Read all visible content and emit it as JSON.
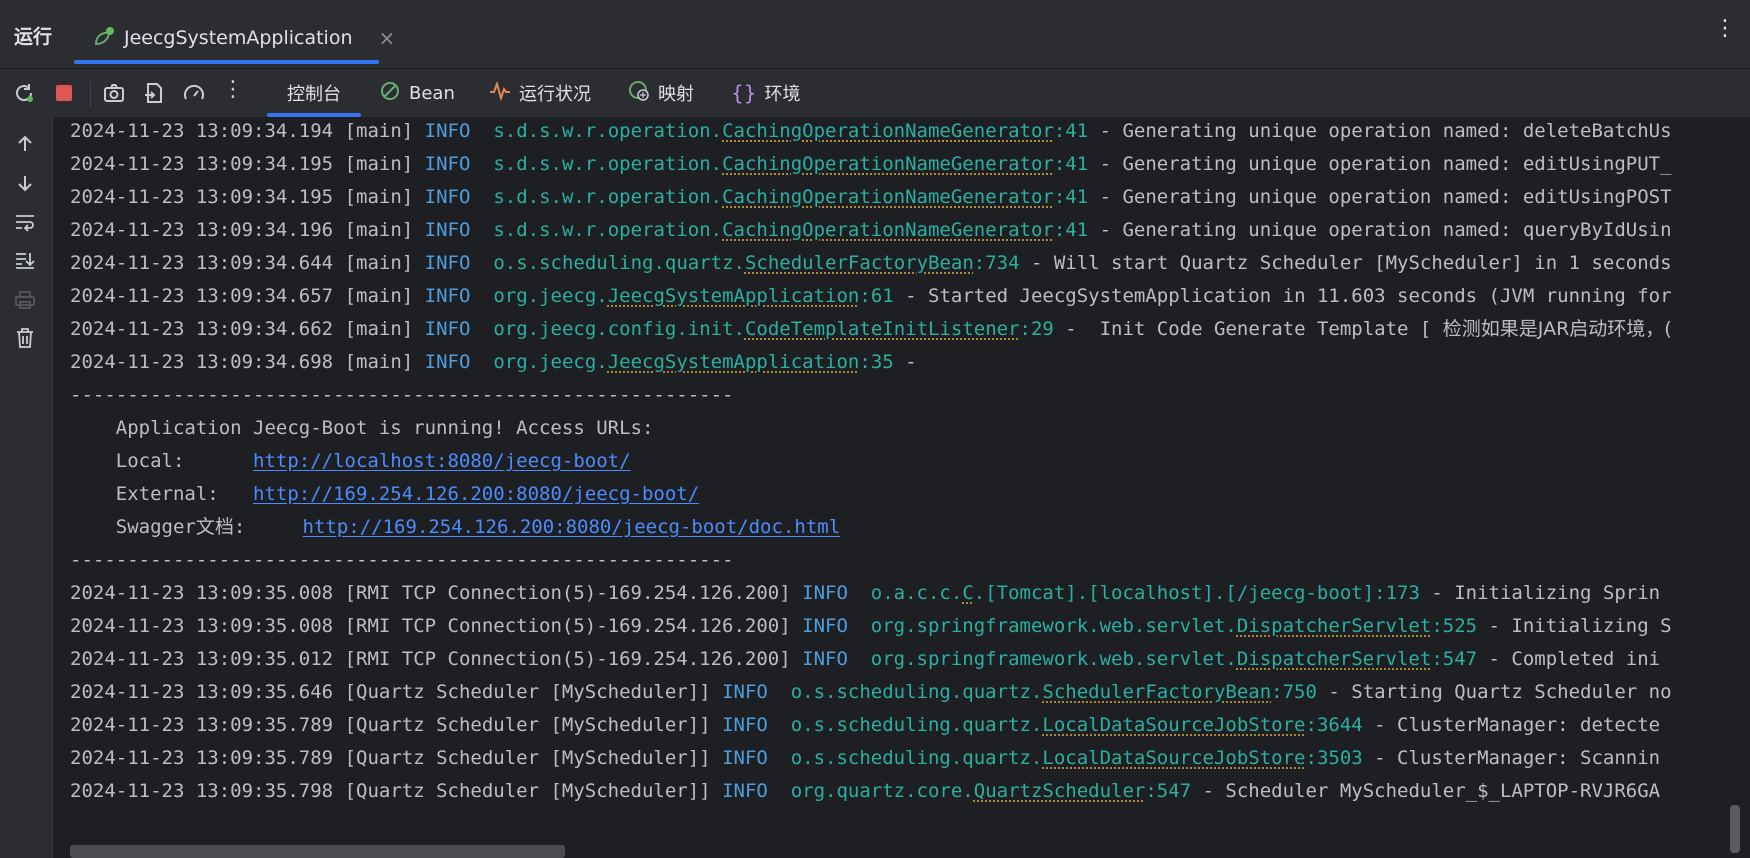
{
  "titlebar": {
    "title": "运行",
    "run_tab": "JeecgSystemApplication",
    "close_glyph": "×",
    "menu_glyph": "⋮"
  },
  "toolbar": {
    "more_glyph": "⋮",
    "tabs": [
      {
        "label": "控制台",
        "icon": "console"
      },
      {
        "label": "Bean",
        "icon": "bean-icon"
      },
      {
        "label": "运行状况",
        "icon": "health-icon"
      },
      {
        "label": "映射",
        "icon": "mapping-icon"
      },
      {
        "label": "环境",
        "icon": "environment-icon"
      }
    ]
  },
  "log": [
    {
      "ts": "2024-11-23 13:09:34.194",
      "thread": "[main]",
      "level": "INFO",
      "pkg": "s.d.s.w.r.operation.",
      "cls": "CachingOperationNameGenerator",
      "line": ":41",
      "msg": " - Generating unique operation named: deleteBatchUs"
    },
    {
      "ts": "2024-11-23 13:09:34.195",
      "thread": "[main]",
      "level": "INFO",
      "pkg": "s.d.s.w.r.operation.",
      "cls": "CachingOperationNameGenerator",
      "line": ":41",
      "msg": " - Generating unique operation named: editUsingPUT_"
    },
    {
      "ts": "2024-11-23 13:09:34.195",
      "thread": "[main]",
      "level": "INFO",
      "pkg": "s.d.s.w.r.operation.",
      "cls": "CachingOperationNameGenerator",
      "line": ":41",
      "msg": " - Generating unique operation named: editUsingPOST"
    },
    {
      "ts": "2024-11-23 13:09:34.196",
      "thread": "[main]",
      "level": "INFO",
      "pkg": "s.d.s.w.r.operation.",
      "cls": "CachingOperationNameGenerator",
      "line": ":41",
      "msg": " - Generating unique operation named: queryByIdUsin"
    },
    {
      "ts": "2024-11-23 13:09:34.644",
      "thread": "[main]",
      "level": "INFO",
      "pkg": "o.s.scheduling.quartz.",
      "cls": "SchedulerFactoryBean",
      "line": ":734",
      "msg": " - Will start Quartz Scheduler [MyScheduler] in 1 seconds"
    },
    {
      "ts": "2024-11-23 13:09:34.657",
      "thread": "[main]",
      "level": "INFO",
      "pkg": "org.jeecg.",
      "cls": "JeecgSystemApplication",
      "line": ":61",
      "msg": " - Started JeecgSystemApplication in 11.603 seconds (JVM running for"
    },
    {
      "ts": "2024-11-23 13:09:34.662",
      "thread": "[main]",
      "level": "INFO",
      "pkg": "org.jeecg.config.init.",
      "cls": "CodeTemplateInitListener",
      "line": ":29",
      "msg": " -  Init Code Generate Template [ ",
      "cjk": "检测如果是JAR启动环境，("
    },
    {
      "ts": "2024-11-23 13:09:34.698",
      "thread": "[main]",
      "level": "INFO",
      "pkg": "org.jeecg.",
      "cls": "JeecgSystemApplication",
      "line": ":35",
      "msg": " -"
    }
  ],
  "banner": {
    "rule": "----------------------------------------------------------",
    "running": "    Application Jeecg-Boot is running! Access URLs:",
    "local_label": "    Local:      ",
    "local_url": "http://localhost:8080/jeecg-boot/",
    "external_label": "    External:   ",
    "external_url": "http://169.254.126.200:8080/jeecg-boot/",
    "swagger_label_a": "    Swagger",
    "swagger_label_cjk": "文档",
    "swagger_label_b": ":     ",
    "swagger_url": "http://169.254.126.200:8080/jeecg-boot/doc.html"
  },
  "log2": [
    {
      "ts": "2024-11-23 13:09:35.008",
      "thread": "[RMI TCP Connection(5)-169.254.126.200]",
      "level": "INFO",
      "pkg": "o.a.c.c.",
      "cls": "C",
      "line": ".[Tomcat].[localhost].[/jeecg-boot]:173",
      "msg": " - Initializing Sprin"
    },
    {
      "ts": "2024-11-23 13:09:35.008",
      "thread": "[RMI TCP Connection(5)-169.254.126.200]",
      "level": "INFO",
      "pkg": "org.springframework.web.servlet.",
      "cls": "DispatcherServlet",
      "line": ":525",
      "msg": " - Initializing S"
    },
    {
      "ts": "2024-11-23 13:09:35.012",
      "thread": "[RMI TCP Connection(5)-169.254.126.200]",
      "level": "INFO",
      "pkg": "org.springframework.web.servlet.",
      "cls": "DispatcherServlet",
      "line": ":547",
      "msg": " - Completed ini"
    },
    {
      "ts": "2024-11-23 13:09:35.646",
      "thread": "[Quartz Scheduler [MyScheduler]]",
      "level": "INFO",
      "pkg": "o.s.scheduling.quartz.",
      "cls": "SchedulerFactoryBean",
      "line": ":750",
      "msg": " - Starting Quartz Scheduler no"
    },
    {
      "ts": "2024-11-23 13:09:35.789",
      "thread": "[Quartz Scheduler [MyScheduler]]",
      "level": "INFO",
      "pkg": "o.s.scheduling.quartz.",
      "cls": "LocalDataSourceJobStore",
      "line": ":3644",
      "msg": " - ClusterManager: detecte"
    },
    {
      "ts": "2024-11-23 13:09:35.789",
      "thread": "[Quartz Scheduler [MyScheduler]]",
      "level": "INFO",
      "pkg": "o.s.scheduling.quartz.",
      "cls": "LocalDataSourceJobStore",
      "line": ":3503",
      "msg": " - ClusterManager: Scannin"
    },
    {
      "ts": "2024-11-23 13:09:35.798",
      "thread": "[Quartz Scheduler [MyScheduler]]",
      "level": "INFO",
      "pkg": "org.quartz.core.",
      "cls": "QuartzScheduler",
      "line": ":547",
      "msg": " - Scheduler MyScheduler_$_LAPTOP-RVJR6GA"
    }
  ],
  "colors": {
    "accent": "#3574f0",
    "info": "#4c9edf",
    "logger": "#2ab0a2",
    "url": "#4c8cff",
    "stop": "#e05555"
  }
}
